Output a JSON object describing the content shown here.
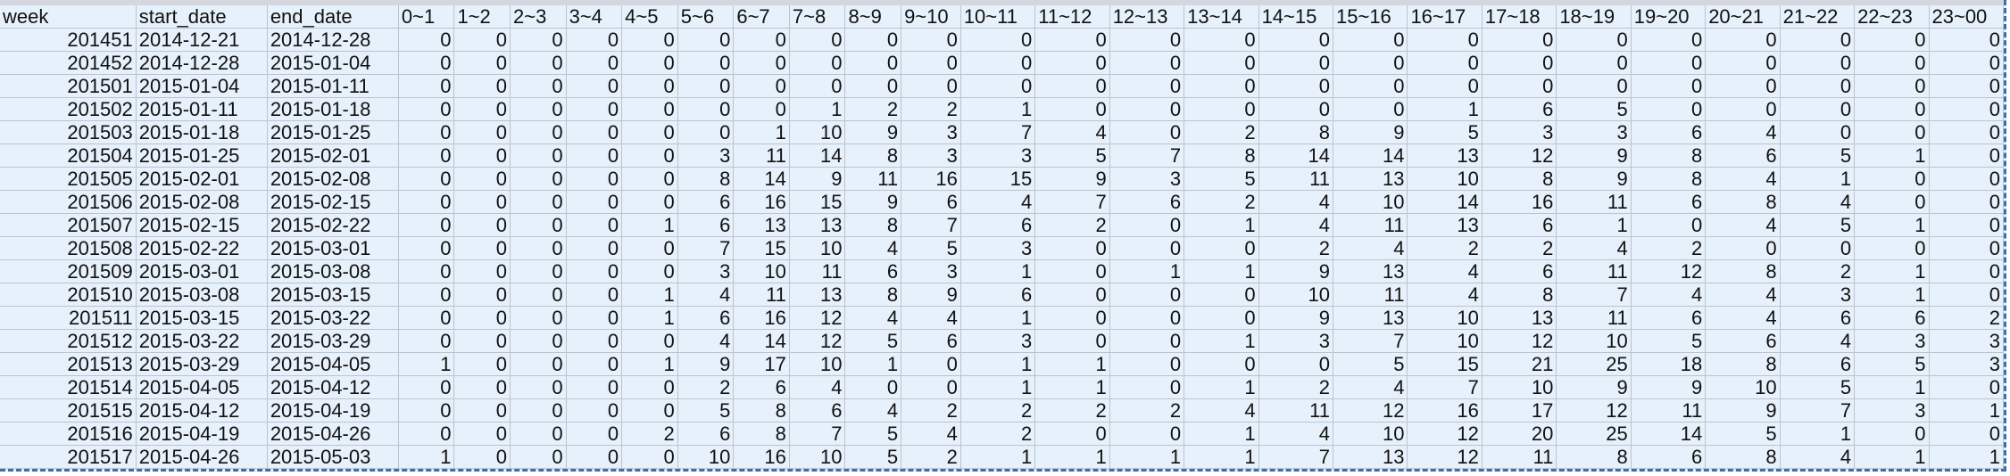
{
  "sheet": {
    "columns": [
      "week",
      "start_date",
      "end_date",
      "0~1",
      "1~2",
      "2~3",
      "3~4",
      "4~5",
      "5~6",
      "6~7",
      "7~8",
      "8~9",
      "9~10",
      "10~11",
      "11~12",
      "12~13",
      "13~14",
      "14~15",
      "15~16",
      "16~17",
      "17~18",
      "18~19",
      "19~20",
      "20~21",
      "21~22",
      "22~23",
      "23~00"
    ],
    "rows": [
      [
        "201451",
        "2014-12-21",
        "2014-12-28",
        "0",
        "0",
        "0",
        "0",
        "0",
        "0",
        "0",
        "0",
        "0",
        "0",
        "0",
        "0",
        "0",
        "0",
        "0",
        "0",
        "0",
        "0",
        "0",
        "0",
        "0",
        "0",
        "0",
        "0"
      ],
      [
        "201452",
        "2014-12-28",
        "2015-01-04",
        "0",
        "0",
        "0",
        "0",
        "0",
        "0",
        "0",
        "0",
        "0",
        "0",
        "0",
        "0",
        "0",
        "0",
        "0",
        "0",
        "0",
        "0",
        "0",
        "0",
        "0",
        "0",
        "0",
        "0"
      ],
      [
        "201501",
        "2015-01-04",
        "2015-01-11",
        "0",
        "0",
        "0",
        "0",
        "0",
        "0",
        "0",
        "0",
        "0",
        "0",
        "0",
        "0",
        "0",
        "0",
        "0",
        "0",
        "0",
        "0",
        "0",
        "0",
        "0",
        "0",
        "0",
        "0"
      ],
      [
        "201502",
        "2015-01-11",
        "2015-01-18",
        "0",
        "0",
        "0",
        "0",
        "0",
        "0",
        "0",
        "1",
        "2",
        "2",
        "1",
        "0",
        "0",
        "0",
        "0",
        "0",
        "1",
        "6",
        "5",
        "0",
        "0",
        "0",
        "0",
        "0"
      ],
      [
        "201503",
        "2015-01-18",
        "2015-01-25",
        "0",
        "0",
        "0",
        "0",
        "0",
        "0",
        "1",
        "10",
        "9",
        "3",
        "7",
        "4",
        "0",
        "2",
        "8",
        "9",
        "5",
        "3",
        "3",
        "6",
        "4",
        "0",
        "0",
        "0"
      ],
      [
        "201504",
        "2015-01-25",
        "2015-02-01",
        "0",
        "0",
        "0",
        "0",
        "0",
        "3",
        "11",
        "14",
        "8",
        "3",
        "3",
        "5",
        "7",
        "8",
        "14",
        "14",
        "13",
        "12",
        "9",
        "8",
        "6",
        "5",
        "1",
        "0"
      ],
      [
        "201505",
        "2015-02-01",
        "2015-02-08",
        "0",
        "0",
        "0",
        "0",
        "0",
        "8",
        "14",
        "9",
        "11",
        "16",
        "15",
        "9",
        "3",
        "5",
        "11",
        "13",
        "10",
        "8",
        "9",
        "8",
        "4",
        "1",
        "0",
        "0"
      ],
      [
        "201506",
        "2015-02-08",
        "2015-02-15",
        "0",
        "0",
        "0",
        "0",
        "0",
        "6",
        "16",
        "15",
        "9",
        "6",
        "4",
        "7",
        "6",
        "2",
        "4",
        "10",
        "14",
        "16",
        "11",
        "6",
        "8",
        "4",
        "0",
        "0"
      ],
      [
        "201507",
        "2015-02-15",
        "2015-02-22",
        "0",
        "0",
        "0",
        "0",
        "1",
        "6",
        "13",
        "13",
        "8",
        "7",
        "6",
        "2",
        "0",
        "1",
        "4",
        "11",
        "13",
        "6",
        "1",
        "0",
        "4",
        "5",
        "1",
        "0"
      ],
      [
        "201508",
        "2015-02-22",
        "2015-03-01",
        "0",
        "0",
        "0",
        "0",
        "0",
        "7",
        "15",
        "10",
        "4",
        "5",
        "3",
        "0",
        "0",
        "0",
        "2",
        "4",
        "2",
        "2",
        "4",
        "2",
        "0",
        "0",
        "0",
        "0"
      ],
      [
        "201509",
        "2015-03-01",
        "2015-03-08",
        "0",
        "0",
        "0",
        "0",
        "0",
        "3",
        "10",
        "11",
        "6",
        "3",
        "1",
        "0",
        "1",
        "1",
        "9",
        "13",
        "4",
        "6",
        "11",
        "12",
        "8",
        "2",
        "1",
        "0"
      ],
      [
        "201510",
        "2015-03-08",
        "2015-03-15",
        "0",
        "0",
        "0",
        "0",
        "1",
        "4",
        "11",
        "13",
        "8",
        "9",
        "6",
        "0",
        "0",
        "0",
        "10",
        "11",
        "4",
        "8",
        "7",
        "4",
        "4",
        "3",
        "1",
        "0"
      ],
      [
        "201511",
        "2015-03-15",
        "2015-03-22",
        "0",
        "0",
        "0",
        "0",
        "1",
        "6",
        "16",
        "12",
        "4",
        "4",
        "1",
        "0",
        "0",
        "0",
        "9",
        "13",
        "10",
        "13",
        "11",
        "6",
        "4",
        "6",
        "6",
        "2"
      ],
      [
        "201512",
        "2015-03-22",
        "2015-03-29",
        "0",
        "0",
        "0",
        "0",
        "0",
        "4",
        "14",
        "12",
        "5",
        "6",
        "3",
        "0",
        "0",
        "1",
        "3",
        "7",
        "10",
        "12",
        "10",
        "5",
        "6",
        "4",
        "3",
        "3"
      ],
      [
        "201513",
        "2015-03-29",
        "2015-04-05",
        "1",
        "0",
        "0",
        "0",
        "1",
        "9",
        "17",
        "10",
        "1",
        "0",
        "1",
        "1",
        "0",
        "0",
        "0",
        "5",
        "15",
        "21",
        "25",
        "18",
        "8",
        "6",
        "5",
        "3"
      ],
      [
        "201514",
        "2015-04-05",
        "2015-04-12",
        "0",
        "0",
        "0",
        "0",
        "0",
        "2",
        "6",
        "4",
        "0",
        "0",
        "1",
        "1",
        "0",
        "1",
        "2",
        "4",
        "7",
        "10",
        "9",
        "9",
        "10",
        "5",
        "1",
        "0"
      ],
      [
        "201515",
        "2015-04-12",
        "2015-04-19",
        "0",
        "0",
        "0",
        "0",
        "0",
        "5",
        "8",
        "6",
        "4",
        "2",
        "2",
        "2",
        "2",
        "4",
        "11",
        "12",
        "16",
        "17",
        "12",
        "11",
        "9",
        "7",
        "3",
        "1"
      ],
      [
        "201516",
        "2015-04-19",
        "2015-04-26",
        "0",
        "0",
        "0",
        "0",
        "2",
        "6",
        "8",
        "7",
        "5",
        "4",
        "2",
        "0",
        "0",
        "1",
        "4",
        "10",
        "12",
        "20",
        "25",
        "14",
        "5",
        "1",
        "0",
        "0"
      ],
      [
        "201517",
        "2015-04-26",
        "2015-05-03",
        "1",
        "0",
        "0",
        "0",
        "0",
        "10",
        "16",
        "10",
        "5",
        "2",
        "1",
        "1",
        "1",
        "1",
        "7",
        "13",
        "12",
        "11",
        "8",
        "6",
        "8",
        "4",
        "1",
        "1"
      ]
    ]
  }
}
